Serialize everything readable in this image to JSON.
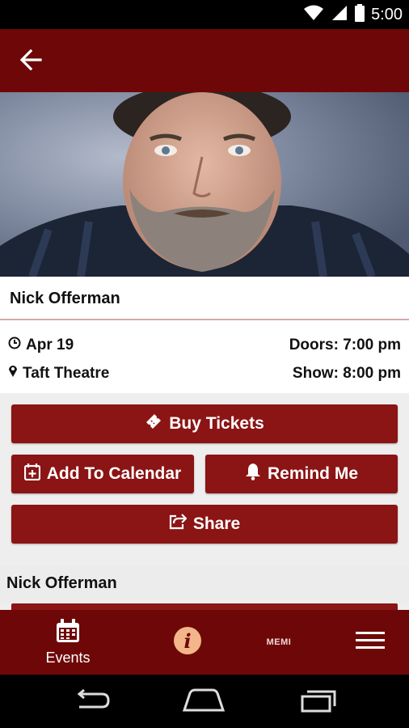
{
  "status_bar": {
    "time": "5:00",
    "icons": [
      "wifi-icon",
      "signal-icon",
      "battery-icon"
    ]
  },
  "app_bar": {
    "back_icon": "arrow-back-icon"
  },
  "hero": {
    "description": "performer-photo"
  },
  "event": {
    "name": "Nick Offerman",
    "date": "Apr 19",
    "venue": "Taft Theatre",
    "doors": "Doors: 7:00 pm",
    "show": "Show: 8:00 pm"
  },
  "actions": {
    "buy_tickets": "Buy Tickets",
    "add_to_calendar": "Add To Calendar",
    "remind_me": "Remind Me",
    "share": "Share"
  },
  "section": {
    "title": "Nick Offerman"
  },
  "bottom_nav": {
    "events_label": "Events",
    "memi_label": "MEMI",
    "icons": [
      "calendar-icon",
      "info-icon",
      "menu-icon"
    ]
  },
  "colors": {
    "primary": "#6e0808",
    "button": "#8b1414",
    "info_accent": "#f3b58a"
  }
}
